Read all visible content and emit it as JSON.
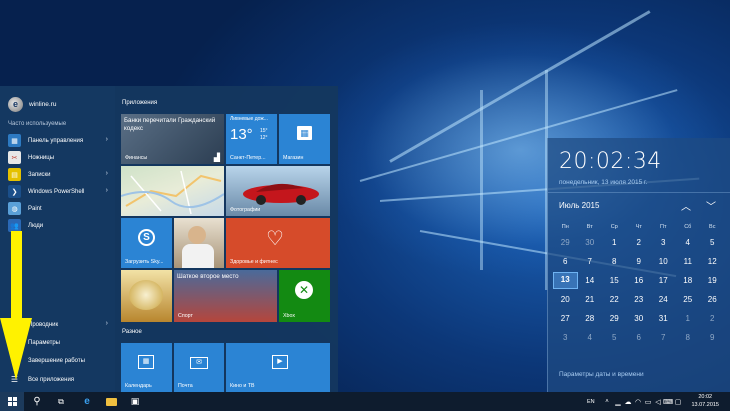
{
  "start_menu": {
    "user_name": "winline.ru",
    "frequent_title": "Часто используемые",
    "apps": [
      {
        "label": "Панель управления",
        "icon": "control-panel-icon",
        "has_submenu": true,
        "color": "#2d7ac2"
      },
      {
        "label": "Ножницы",
        "icon": "scissors-icon",
        "has_submenu": false,
        "color": "#c0392b"
      },
      {
        "label": "Записки",
        "icon": "sticky-notes-icon",
        "has_submenu": true,
        "color": "#e5c100"
      },
      {
        "label": "Windows PowerShell",
        "icon": "powershell-icon",
        "has_submenu": true,
        "color": "#1b4f8a"
      },
      {
        "label": "Paint",
        "icon": "paint-icon",
        "has_submenu": false,
        "color": "#5aa0d8"
      },
      {
        "label": "Люди",
        "icon": "people-icon",
        "has_submenu": false,
        "color": "#2a68b5"
      }
    ],
    "bottom": {
      "explorer": "Проводник",
      "settings": "Параметры",
      "power": "Завершение работы",
      "all_apps": "Все приложения"
    },
    "groups": {
      "apps": "Приложения",
      "misc": "Разное"
    },
    "tiles": {
      "finance": {
        "headline": "Банки перечитали Гражданский кодекс",
        "label": "Финансы"
      },
      "weather": {
        "condition": "Ливневые дож...",
        "temp": "13°",
        "high": "15°",
        "low": "12°",
        "label": "Санкт-Петер..."
      },
      "store": {
        "label": "Магазин"
      },
      "maps": {
        "label": ""
      },
      "photos": {
        "label": "Фотографии"
      },
      "skype": {
        "label": "Загрузить Sky..."
      },
      "health": {
        "label": "Здоровье и фитнес"
      },
      "sport": {
        "headline": "Шаткое второе место",
        "label": "Спорт"
      },
      "xbox": {
        "label": "Xbox"
      },
      "calendar": {
        "label": "Календарь"
      },
      "mail": {
        "label": "Почта"
      },
      "movies": {
        "label": "Кино и ТВ"
      }
    }
  },
  "calendar": {
    "time": "20:02:34",
    "date": "понедельник, 13 июля 2015 г.",
    "month": "Июль 2015",
    "weekdays": [
      "Пн",
      "Вт",
      "Ср",
      "Чт",
      "Пт",
      "Сб",
      "Вс"
    ],
    "weeks": [
      [
        "29",
        "30",
        "1",
        "2",
        "3",
        "4",
        "5"
      ],
      [
        "6",
        "7",
        "8",
        "9",
        "10",
        "11",
        "12"
      ],
      [
        "13",
        "14",
        "15",
        "16",
        "17",
        "18",
        "19"
      ],
      [
        "20",
        "21",
        "22",
        "23",
        "24",
        "25",
        "26"
      ],
      [
        "27",
        "28",
        "29",
        "30",
        "31",
        "1",
        "2"
      ],
      [
        "3",
        "4",
        "5",
        "6",
        "7",
        "8",
        "9"
      ]
    ],
    "settings_link": "Параметры даты и времени",
    "today": "13"
  },
  "taskbar": {
    "lang": "EN",
    "time": "20:02",
    "date": "13.07.2015"
  },
  "colors": {
    "tile_blue": "#2b84d4",
    "tile_red": "#d64b2a",
    "tile_green": "#138a12",
    "annotation_arrow": "#fff200"
  }
}
